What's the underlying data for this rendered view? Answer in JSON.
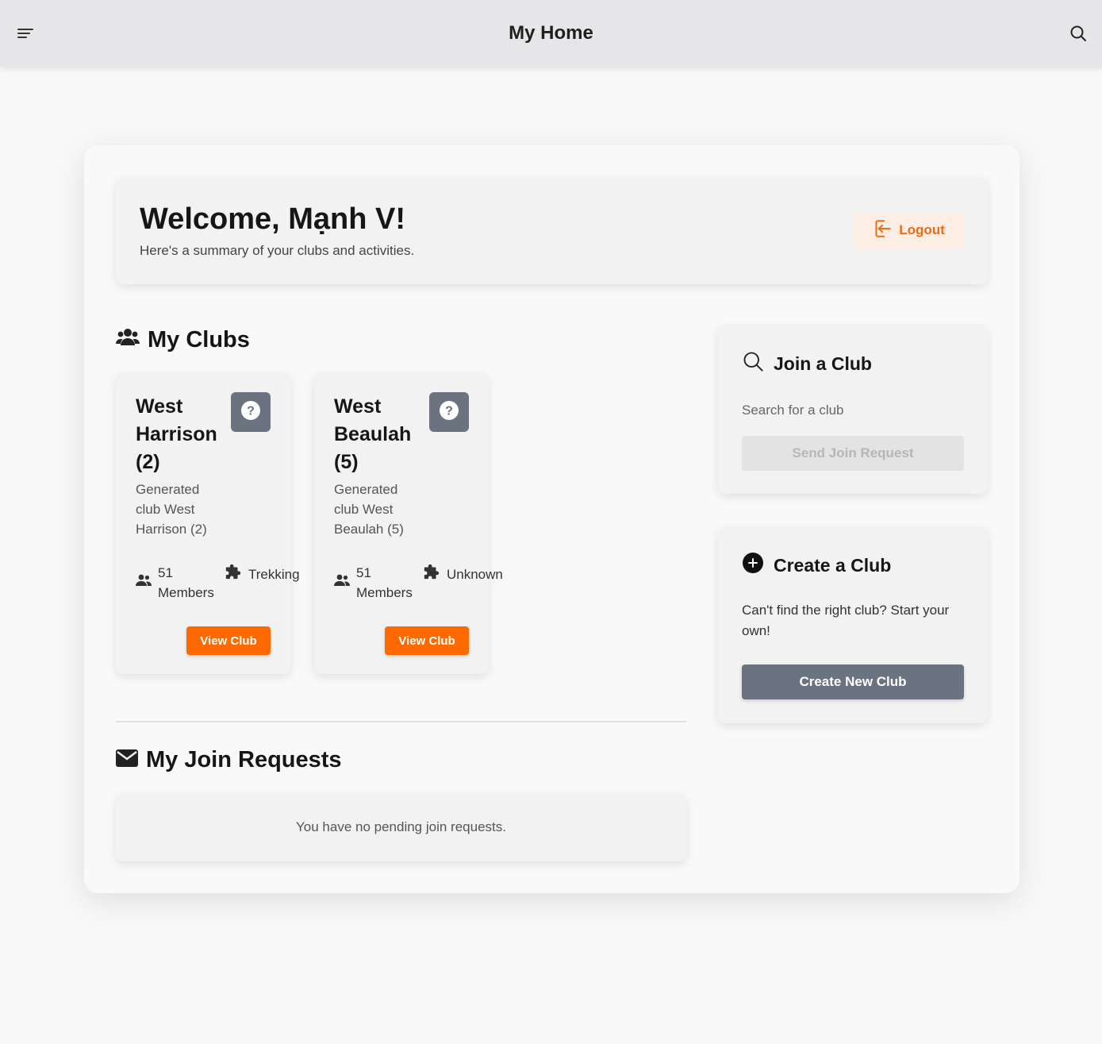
{
  "header": {
    "title": "My Home",
    "menu_icon": "menu-icon",
    "search_icon": "search-icon"
  },
  "welcome": {
    "title": "Welcome, Mạnh V!",
    "subtitle": "Here's a summary of your clubs and activities.",
    "logout_label": "Logout"
  },
  "my_clubs": {
    "title": "My Clubs",
    "clubs": [
      {
        "name": "West Harrison (2)",
        "description": "Generated club West Harrison (2)",
        "members_count": "51",
        "members_label": "Members",
        "category": "Trekking",
        "view_label": "View Club"
      },
      {
        "name": "West Beaulah (5)",
        "description": "Generated club West Beaulah (5)",
        "members_count": "51",
        "members_label": "Members",
        "category": "Unknown",
        "view_label": "View Club"
      }
    ]
  },
  "join_requests": {
    "title": "My Join Requests",
    "empty_text": "You have no pending join requests."
  },
  "join_club": {
    "title": "Join a Club",
    "search_placeholder": "Search for a club",
    "send_label": "Send Join Request"
  },
  "create_club": {
    "title": "Create a Club",
    "text": "Can't find the right club? Start your own!",
    "button_label": "Create New Club"
  },
  "colors": {
    "accent": "#ff6a00",
    "slate": "#6b7280",
    "topbar": "#e6e6e8"
  }
}
